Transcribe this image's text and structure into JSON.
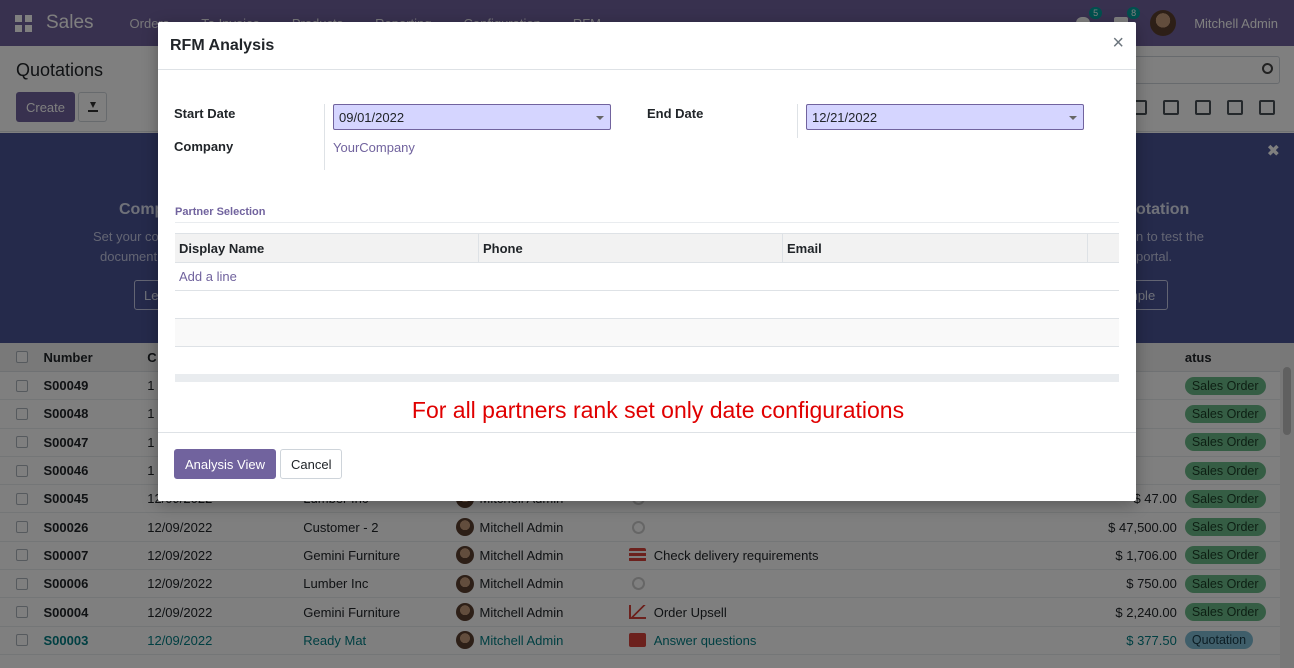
{
  "navbar": {
    "app_name": "Sales",
    "menu": [
      "Orders",
      "To Invoice",
      "Products",
      "Reporting",
      "Configuration",
      "RFM"
    ],
    "messages_count": "5",
    "activities_count": "8",
    "user": "Mitchell Admin"
  },
  "control_panel": {
    "title": "Quotations",
    "create_label": "Create"
  },
  "banner": {
    "left_title": "Comp",
    "left_text_1": "Set your co",
    "left_text_2": "document",
    "left_button": "Le",
    "right_title": "otation",
    "right_text_1": "n to test the",
    "right_text_2": "portal.",
    "right_button": "mple"
  },
  "list": {
    "headers": {
      "number": "Number",
      "date": "C",
      "status": "atus"
    },
    "rows": [
      {
        "number": "S00049",
        "date": "1",
        "customer": "",
        "salesperson": "",
        "activity": "",
        "activity_icon": "",
        "total": "",
        "status": "Sales Order",
        "status_type": "sale",
        "link": false
      },
      {
        "number": "S00048",
        "date": "1",
        "customer": "",
        "salesperson": "",
        "activity": "",
        "activity_icon": "",
        "total": "",
        "status": "Sales Order",
        "status_type": "sale",
        "link": false
      },
      {
        "number": "S00047",
        "date": "1",
        "customer": "",
        "salesperson": "",
        "activity": "",
        "activity_icon": "",
        "total": "",
        "status": "Sales Order",
        "status_type": "sale",
        "link": false
      },
      {
        "number": "S00046",
        "date": "1",
        "customer": "",
        "salesperson": "",
        "activity": "",
        "activity_icon": "",
        "total": "",
        "status": "Sales Order",
        "status_type": "sale",
        "link": false
      },
      {
        "number": "S00045",
        "date": "12/09/2022",
        "customer": "Lumber Inc",
        "salesperson": "Mitchell Admin",
        "activity": "",
        "activity_icon": "clock",
        "total": "$ 47.00",
        "status": "Sales Order",
        "status_type": "sale",
        "link": false
      },
      {
        "number": "S00026",
        "date": "12/09/2022",
        "customer": "Customer - 2",
        "salesperson": "Mitchell Admin",
        "activity": "",
        "activity_icon": "clock",
        "total": "$ 47,500.00",
        "status": "Sales Order",
        "status_type": "sale",
        "link": false
      },
      {
        "number": "S00007",
        "date": "12/09/2022",
        "customer": "Gemini Furniture",
        "salesperson": "Mitchell Admin",
        "activity": "Check delivery requirements",
        "activity_icon": "delivery",
        "total": "$ 1,706.00",
        "status": "Sales Order",
        "status_type": "sale",
        "link": false
      },
      {
        "number": "S00006",
        "date": "12/09/2022",
        "customer": "Lumber Inc",
        "salesperson": "Mitchell Admin",
        "activity": "",
        "activity_icon": "clock",
        "total": "$ 750.00",
        "status": "Sales Order",
        "status_type": "sale",
        "link": false
      },
      {
        "number": "S00004",
        "date": "12/09/2022",
        "customer": "Gemini Furniture",
        "salesperson": "Mitchell Admin",
        "activity": "Order Upsell",
        "activity_icon": "upsell",
        "total": "$ 2,240.00",
        "status": "Sales Order",
        "status_type": "sale",
        "link": false
      },
      {
        "number": "S00003",
        "date": "12/09/2022",
        "customer": "Ready Mat",
        "salesperson": "Mitchell Admin",
        "activity": "Answer questions",
        "activity_icon": "mail",
        "total": "$ 377.50",
        "status": "Quotation",
        "status_type": "quote",
        "link": true
      }
    ]
  },
  "modal": {
    "title": "RFM Analysis",
    "close_symbol": "×",
    "start_date_label": "Start Date",
    "start_date_value": "09/01/2022",
    "end_date_label": "End Date",
    "end_date_value": "12/21/2022",
    "company_label": "Company",
    "company_value": "YourCompany",
    "partner_section_title": "Partner Selection",
    "columns": {
      "name": "Display Name",
      "phone": "Phone",
      "email": "Email"
    },
    "add_line": "Add a line",
    "annotation": "For all partners rank set only date configurations",
    "primary_button": "Analysis View",
    "cancel_button": "Cancel"
  },
  "colors": {
    "brand": "#71639e",
    "banner": "#4b5597",
    "annotation": "#e00000",
    "date_input_bg": "#d5d5ff"
  }
}
